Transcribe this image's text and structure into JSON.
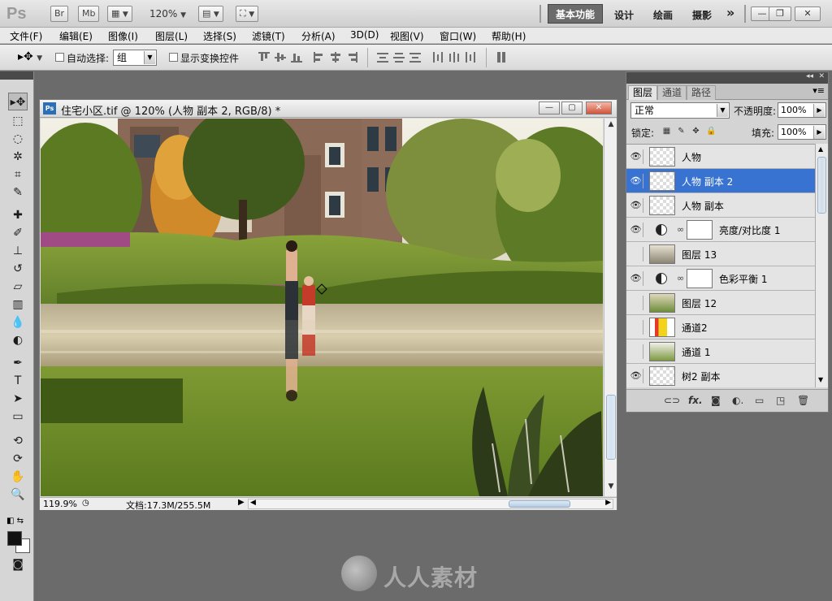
{
  "app": {
    "logo": "Ps",
    "bridge_label": "Br",
    "minibridge_label": "Mb",
    "zoom_level": "120%",
    "workspaces": [
      "基本功能",
      "设计",
      "绘画",
      "摄影"
    ],
    "more_workspaces": "»",
    "window_buttons": [
      "—",
      "❐",
      "✕"
    ]
  },
  "menu": [
    "文件(F)",
    "编辑(E)",
    "图像(I)",
    "图层(L)",
    "选择(S)",
    "滤镜(T)",
    "分析(A)",
    "3D(D)",
    "视图(V)",
    "窗口(W)",
    "帮助(H)"
  ],
  "options": {
    "auto_select_label": "自动选择:",
    "auto_select_value": "组",
    "show_transform_label": "显示变换控件"
  },
  "document": {
    "title": "住宅小区.tif @ 120% (人物 副本 2, RGB/8) *",
    "zoom": "119.9%",
    "doc_info": "文档:17.3M/255.5M"
  },
  "layers_panel": {
    "tabs": [
      "图层",
      "通道",
      "路径"
    ],
    "active_tab": 0,
    "blend_mode": "正常",
    "opacity_label": "不透明度:",
    "opacity_value": "100%",
    "lock_label": "锁定:",
    "fill_label": "填充:",
    "fill_value": "100%",
    "layers": [
      {
        "name": "人物",
        "visible": true,
        "kind": "transparent",
        "selected": false
      },
      {
        "name": "人物 副本 2",
        "visible": true,
        "kind": "transparent",
        "selected": true
      },
      {
        "name": "人物 副本",
        "visible": true,
        "kind": "transparent",
        "selected": false
      },
      {
        "name": "亮度/对比度 1",
        "visible": true,
        "kind": "adjustment",
        "selected": false
      },
      {
        "name": "图层 13",
        "visible": false,
        "kind": "image",
        "selected": false
      },
      {
        "name": "色彩平衡 1",
        "visible": true,
        "kind": "adjustment",
        "selected": false
      },
      {
        "name": "图层 12",
        "visible": false,
        "kind": "image",
        "selected": false
      },
      {
        "name": "通道2",
        "visible": false,
        "kind": "image",
        "selected": false
      },
      {
        "name": "通道 1",
        "visible": false,
        "kind": "image",
        "selected": false
      },
      {
        "name": "树2 副本",
        "visible": true,
        "kind": "transparent",
        "selected": false
      }
    ],
    "footer_icons": [
      "link-icon",
      "fx-icon",
      "mask-icon",
      "adjustment-icon",
      "group-icon",
      "new-layer-icon",
      "trash-icon"
    ]
  },
  "watermark": "人人素材"
}
